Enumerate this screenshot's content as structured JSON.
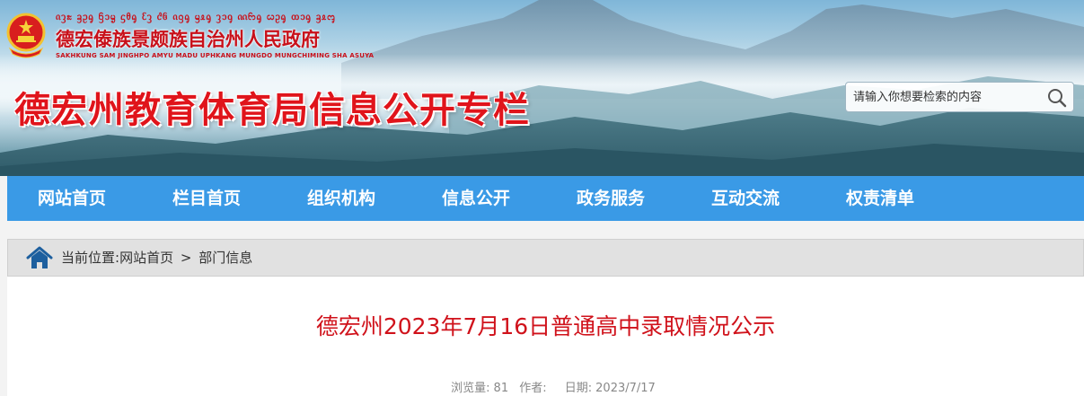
{
  "header": {
    "minority_script": "ᦵᦡᦰ ᦃᦳᧂ ᦌᦱᧄ ᦓᦲᧂ ᦷᦡ ᦺᦑ ᦵᦋᧂ ᦙᦸᧂ ᦡᦱᧁ ᦶᦝᧂ ᦍᦳᧂ ᦎᦱᧂ ᦃᦸᧅ",
    "gov_name": "德宏傣族景颇族自治州人民政府",
    "gov_latin": "SAKHKUNG SAM JINGHPO AMYU MADU UPHKANG MUNGDO MUNGCHIMING SHA ASUYA",
    "site_title": "德宏州教育体育局信息公开专栏"
  },
  "search": {
    "placeholder": "请输入你想要检索的内容"
  },
  "nav": {
    "items": [
      {
        "label": "网站首页"
      },
      {
        "label": "栏目首页"
      },
      {
        "label": "组织机构"
      },
      {
        "label": "信息公开"
      },
      {
        "label": "政务服务"
      },
      {
        "label": "互动交流"
      },
      {
        "label": "权责清单"
      }
    ]
  },
  "breadcrumb": {
    "prefix": "当前位置:",
    "home": "网站首页",
    "separator": ">",
    "current": "部门信息"
  },
  "article": {
    "title": "德宏州2023年7月16日普通高中录取情况公示",
    "views_label": "浏览量:",
    "views_value": "81",
    "author_label": "作者:",
    "author_value": "",
    "date_label": "日期:",
    "date_value": "2023/7/17"
  },
  "colors": {
    "nav_bg": "#3a9ae6",
    "title_red": "#e0141b",
    "article_title_red": "#d0121b",
    "breadcrumb_bg": "#e1e1e1"
  }
}
